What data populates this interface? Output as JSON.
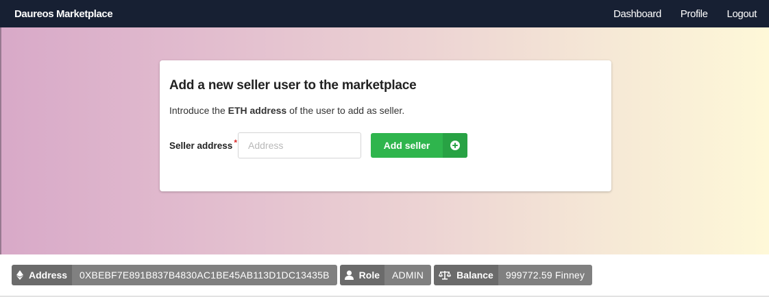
{
  "navbar": {
    "brand": "Daureos Marketplace",
    "links": {
      "dashboard": "Dashboard",
      "profile": "Profile",
      "logout": "Logout"
    }
  },
  "card": {
    "title": "Add a new seller user to the marketplace",
    "desc_prefix": "Introduce the ",
    "desc_bold": "ETH address",
    "desc_suffix": " of the user to add as seller.",
    "field_label": "Seller address",
    "required_mark": "*",
    "input_placeholder": "Address",
    "input_value": "",
    "button_label": "Add seller",
    "button_icon": "plus-circle-icon"
  },
  "footer": {
    "address": {
      "key": "Address",
      "value": "0XBEBF7E891B837B4830AC1BE45AB113D1DC13435B",
      "icon": "ethereum-icon"
    },
    "role": {
      "key": "Role",
      "value": "ADMIN",
      "icon": "user-icon"
    },
    "balance": {
      "key": "Balance",
      "value": "999772.59 Finney",
      "icon": "balance-scale-icon"
    }
  },
  "colors": {
    "navbar": "#172033",
    "button": "#2fb54d",
    "button_icon_bg": "#28a244",
    "tag_key": "#6b6b6b",
    "tag_value": "#808080",
    "required": "#db2828"
  }
}
